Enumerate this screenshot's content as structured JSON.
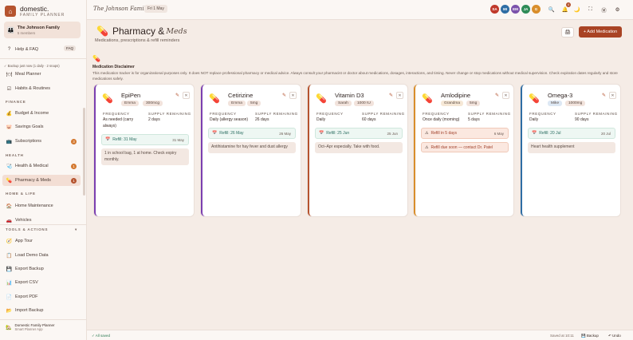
{
  "app": {
    "name": "domestic.",
    "subtitle": "FAMILY PLANNER"
  },
  "family": {
    "name": "The Johnson Family",
    "members": "5 members"
  },
  "sidebar": {
    "help": "Help & FAQ",
    "faq_badge": "FAQ",
    "backup_note": "✓ Backup just now (1 daily · 2 snaps)",
    "items_top": [
      "Meal Planner",
      "Habits & Routines"
    ],
    "finance_header": "FINANCE",
    "finance_items": [
      "Budget & Income",
      "Savings Goals",
      "Subscriptions"
    ],
    "subscriptions_count": "3",
    "health_header": "HEALTH",
    "health_items": [
      "Health & Medical",
      "Pharmacy & Meds"
    ],
    "health_count": "1",
    "pharmacy_count": "1",
    "home_header": "HOME & LIFE",
    "home_items": [
      "Home Maintenance",
      "Vehicles"
    ],
    "tools_header": "TOOLS & ACTIONS",
    "tools_items": [
      "App Tour",
      "Load Demo Data",
      "Export Backup",
      "Export CSV",
      "Export PDF",
      "Import Backup"
    ],
    "footer_name": "Domestic Family Planner",
    "footer_sub": "Smart Planner App"
  },
  "topbar": {
    "family_title": "The Johnson Family",
    "date": "Fri 1 May",
    "avatars": [
      {
        "initials": "SA",
        "color": "#c0392b"
      },
      {
        "initials": "MI",
        "color": "#2e6da4"
      },
      {
        "initials": "EM",
        "color": "#7b52ab"
      },
      {
        "initials": "JA",
        "color": "#2e8b57"
      },
      {
        "initials": "G",
        "color": "#d98e2b"
      }
    ],
    "notification_count": "4"
  },
  "page": {
    "title_main": "Pharmacy &",
    "title_italic": "Meds",
    "subtitle": "Medications, prescriptions & refill reminders",
    "add_button": "+ Add Medication"
  },
  "disclaimer": {
    "title": "Medication Disclaimer",
    "body": "This medication tracker is for organizational purposes only. It does NOT replace professional pharmacy or medical advice. Always consult your pharmacist or doctor about medications, dosages, interactions, and timing. Never change or stop medications without medical supervision. Check expiration dates regularly and store medications safely."
  },
  "labels": {
    "frequency": "FREQUENCY",
    "supply": "SUPPLY REMAINING"
  },
  "medications": [
    {
      "name": "EpiPen",
      "person": "Emma",
      "dose": "300mcg",
      "frequency": "As needed (carry always)",
      "supply": "2 days",
      "refill": "Refill: 31 May",
      "refill_date": "31 May",
      "note": "1 in school bag, 1 at home. Check expiry monthly.",
      "accent": "#7b3fb0"
    },
    {
      "name": "Cetirizine",
      "person": "Emma",
      "dose": "5mg",
      "frequency": "Daily (allergy season)",
      "supply": "26 days",
      "refill": "Refill: 26 May",
      "refill_date": "26 May",
      "note": "Antihistamine for hay fever and dust allergy",
      "accent": "#7b3fb0"
    },
    {
      "name": "Vitamin D3",
      "person": "Sarah",
      "dose": "1000 IU",
      "frequency": "Daily",
      "supply": "60 days",
      "refill": "Refill: 25 Jun",
      "refill_date": "25 Jun",
      "note": "Oct–Apr especially. Take with food.",
      "accent": "#b5532e"
    },
    {
      "name": "Amlodipine",
      "person": "Grandma",
      "dose": "5mg",
      "frequency": "Once daily (morning)",
      "supply": "5 days",
      "refill": "Refill in 5 days",
      "refill_date": "6 May",
      "note": "Refill due soon — contact Dr. Patel",
      "accent": "#d98e2b"
    },
    {
      "name": "Omega-3",
      "person": "Mike",
      "dose": "1000mg",
      "frequency": "Daily",
      "supply": "90 days",
      "refill": "Refill: 20 Jul",
      "refill_date": "20 Jul",
      "note": "Heart health supplement",
      "accent": "#2e6da4"
    }
  ],
  "statusbar": {
    "saved": "✓ All saved",
    "time": "Saved at 10:11",
    "backup": "Backup",
    "undo": "↶ Undo"
  }
}
